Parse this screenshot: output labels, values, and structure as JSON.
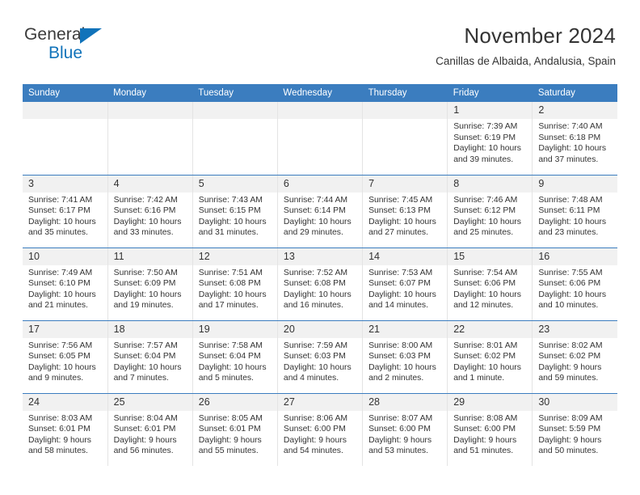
{
  "logo": {
    "word1": "General",
    "word2": "Blue",
    "triangle_color": "#1173ba"
  },
  "header": {
    "title": "November 2024",
    "subtitle": "Canillas de Albaida, Andalusia, Spain"
  },
  "theme": {
    "header_blue": "#3b7dbf",
    "daynum_bg": "#f1f1f1",
    "text": "#333333"
  },
  "weekdays": [
    "Sunday",
    "Monday",
    "Tuesday",
    "Wednesday",
    "Thursday",
    "Friday",
    "Saturday"
  ],
  "labels": {
    "sunrise": "Sunrise:",
    "sunset": "Sunset:",
    "daylight": "Daylight:"
  },
  "weeks": [
    [
      {
        "day": "",
        "empty": true
      },
      {
        "day": "",
        "empty": true
      },
      {
        "day": "",
        "empty": true
      },
      {
        "day": "",
        "empty": true
      },
      {
        "day": "",
        "empty": true
      },
      {
        "day": "1",
        "sunrise": "Sunrise: 7:39 AM",
        "sunset": "Sunset: 6:19 PM",
        "daylight": "Daylight: 10 hours and 39 minutes."
      },
      {
        "day": "2",
        "sunrise": "Sunrise: 7:40 AM",
        "sunset": "Sunset: 6:18 PM",
        "daylight": "Daylight: 10 hours and 37 minutes."
      }
    ],
    [
      {
        "day": "3",
        "sunrise": "Sunrise: 7:41 AM",
        "sunset": "Sunset: 6:17 PM",
        "daylight": "Daylight: 10 hours and 35 minutes."
      },
      {
        "day": "4",
        "sunrise": "Sunrise: 7:42 AM",
        "sunset": "Sunset: 6:16 PM",
        "daylight": "Daylight: 10 hours and 33 minutes."
      },
      {
        "day": "5",
        "sunrise": "Sunrise: 7:43 AM",
        "sunset": "Sunset: 6:15 PM",
        "daylight": "Daylight: 10 hours and 31 minutes."
      },
      {
        "day": "6",
        "sunrise": "Sunrise: 7:44 AM",
        "sunset": "Sunset: 6:14 PM",
        "daylight": "Daylight: 10 hours and 29 minutes."
      },
      {
        "day": "7",
        "sunrise": "Sunrise: 7:45 AM",
        "sunset": "Sunset: 6:13 PM",
        "daylight": "Daylight: 10 hours and 27 minutes."
      },
      {
        "day": "8",
        "sunrise": "Sunrise: 7:46 AM",
        "sunset": "Sunset: 6:12 PM",
        "daylight": "Daylight: 10 hours and 25 minutes."
      },
      {
        "day": "9",
        "sunrise": "Sunrise: 7:48 AM",
        "sunset": "Sunset: 6:11 PM",
        "daylight": "Daylight: 10 hours and 23 minutes."
      }
    ],
    [
      {
        "day": "10",
        "sunrise": "Sunrise: 7:49 AM",
        "sunset": "Sunset: 6:10 PM",
        "daylight": "Daylight: 10 hours and 21 minutes."
      },
      {
        "day": "11",
        "sunrise": "Sunrise: 7:50 AM",
        "sunset": "Sunset: 6:09 PM",
        "daylight": "Daylight: 10 hours and 19 minutes."
      },
      {
        "day": "12",
        "sunrise": "Sunrise: 7:51 AM",
        "sunset": "Sunset: 6:08 PM",
        "daylight": "Daylight: 10 hours and 17 minutes."
      },
      {
        "day": "13",
        "sunrise": "Sunrise: 7:52 AM",
        "sunset": "Sunset: 6:08 PM",
        "daylight": "Daylight: 10 hours and 16 minutes."
      },
      {
        "day": "14",
        "sunrise": "Sunrise: 7:53 AM",
        "sunset": "Sunset: 6:07 PM",
        "daylight": "Daylight: 10 hours and 14 minutes."
      },
      {
        "day": "15",
        "sunrise": "Sunrise: 7:54 AM",
        "sunset": "Sunset: 6:06 PM",
        "daylight": "Daylight: 10 hours and 12 minutes."
      },
      {
        "day": "16",
        "sunrise": "Sunrise: 7:55 AM",
        "sunset": "Sunset: 6:06 PM",
        "daylight": "Daylight: 10 hours and 10 minutes."
      }
    ],
    [
      {
        "day": "17",
        "sunrise": "Sunrise: 7:56 AM",
        "sunset": "Sunset: 6:05 PM",
        "daylight": "Daylight: 10 hours and 9 minutes."
      },
      {
        "day": "18",
        "sunrise": "Sunrise: 7:57 AM",
        "sunset": "Sunset: 6:04 PM",
        "daylight": "Daylight: 10 hours and 7 minutes."
      },
      {
        "day": "19",
        "sunrise": "Sunrise: 7:58 AM",
        "sunset": "Sunset: 6:04 PM",
        "daylight": "Daylight: 10 hours and 5 minutes."
      },
      {
        "day": "20",
        "sunrise": "Sunrise: 7:59 AM",
        "sunset": "Sunset: 6:03 PM",
        "daylight": "Daylight: 10 hours and 4 minutes."
      },
      {
        "day": "21",
        "sunrise": "Sunrise: 8:00 AM",
        "sunset": "Sunset: 6:03 PM",
        "daylight": "Daylight: 10 hours and 2 minutes."
      },
      {
        "day": "22",
        "sunrise": "Sunrise: 8:01 AM",
        "sunset": "Sunset: 6:02 PM",
        "daylight": "Daylight: 10 hours and 1 minute."
      },
      {
        "day": "23",
        "sunrise": "Sunrise: 8:02 AM",
        "sunset": "Sunset: 6:02 PM",
        "daylight": "Daylight: 9 hours and 59 minutes."
      }
    ],
    [
      {
        "day": "24",
        "sunrise": "Sunrise: 8:03 AM",
        "sunset": "Sunset: 6:01 PM",
        "daylight": "Daylight: 9 hours and 58 minutes."
      },
      {
        "day": "25",
        "sunrise": "Sunrise: 8:04 AM",
        "sunset": "Sunset: 6:01 PM",
        "daylight": "Daylight: 9 hours and 56 minutes."
      },
      {
        "day": "26",
        "sunrise": "Sunrise: 8:05 AM",
        "sunset": "Sunset: 6:01 PM",
        "daylight": "Daylight: 9 hours and 55 minutes."
      },
      {
        "day": "27",
        "sunrise": "Sunrise: 8:06 AM",
        "sunset": "Sunset: 6:00 PM",
        "daylight": "Daylight: 9 hours and 54 minutes."
      },
      {
        "day": "28",
        "sunrise": "Sunrise: 8:07 AM",
        "sunset": "Sunset: 6:00 PM",
        "daylight": "Daylight: 9 hours and 53 minutes."
      },
      {
        "day": "29",
        "sunrise": "Sunrise: 8:08 AM",
        "sunset": "Sunset: 6:00 PM",
        "daylight": "Daylight: 9 hours and 51 minutes."
      },
      {
        "day": "30",
        "sunrise": "Sunrise: 8:09 AM",
        "sunset": "Sunset: 5:59 PM",
        "daylight": "Daylight: 9 hours and 50 minutes."
      }
    ]
  ]
}
